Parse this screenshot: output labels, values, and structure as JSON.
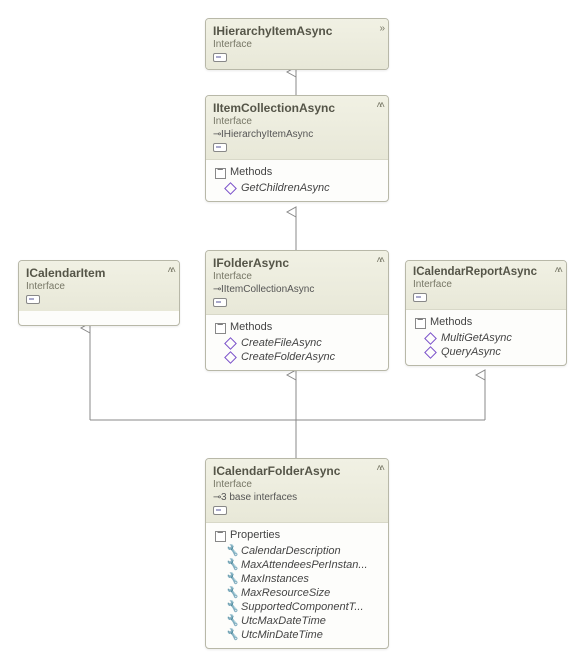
{
  "stereotype": "Interface",
  "boxes": {
    "hier": {
      "title": "IHierarchyItemAsync"
    },
    "itemcoll": {
      "title": "IItemCollectionAsync",
      "base": "IHierarchyItemAsync",
      "section": "Methods",
      "members": [
        "GetChildrenAsync"
      ]
    },
    "calitem": {
      "title": "ICalendarItem"
    },
    "folder": {
      "title": "IFolderAsync",
      "base": "IItemCollectionAsync",
      "section": "Methods",
      "members": [
        "CreateFileAsync",
        "CreateFolderAsync"
      ]
    },
    "report": {
      "title": "ICalendarReportAsync",
      "section": "Methods",
      "members": [
        "MultiGetAsync",
        "QueryAsync"
      ]
    },
    "calfolder": {
      "title": "ICalendarFolderAsync",
      "base": "3 base interfaces",
      "section": "Properties",
      "members": [
        "CalendarDescription",
        "MaxAttendeesPerInstan...",
        "MaxInstances",
        "MaxResourceSize",
        "SupportedComponentT...",
        "UtcMaxDateTime",
        "UtcMinDateTime"
      ]
    }
  }
}
